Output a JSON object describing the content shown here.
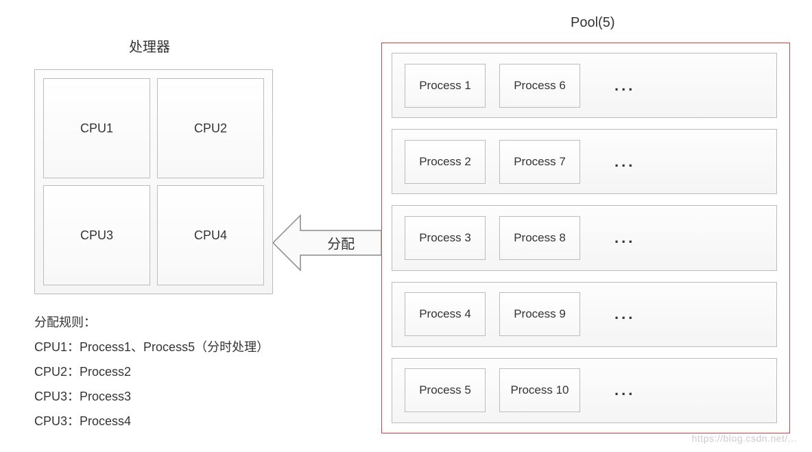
{
  "cpu": {
    "title": "处理器",
    "cells": [
      "CPU1",
      "CPU2",
      "CPU3",
      "CPU4"
    ]
  },
  "pool": {
    "title": "Pool(5)",
    "slot_count": 5,
    "slots": [
      {
        "left": "Process 1",
        "right": "Process 6",
        "more": "..."
      },
      {
        "left": "Process 2",
        "right": "Process 7",
        "more": "..."
      },
      {
        "left": "Process 3",
        "right": "Process 8",
        "more": "..."
      },
      {
        "left": "Process 4",
        "right": "Process 9",
        "more": "..."
      },
      {
        "left": "Process 5",
        "right": "Process 10",
        "more": "..."
      }
    ]
  },
  "arrow": {
    "label": "分配"
  },
  "rules": {
    "heading": "分配规则：",
    "lines": [
      "CPU1：Process1、Process5（分时处理）",
      "CPU2：Process2",
      "CPU3：Process3",
      "CPU3：Process4"
    ]
  },
  "watermark": "https://blog.csdn.net/..."
}
